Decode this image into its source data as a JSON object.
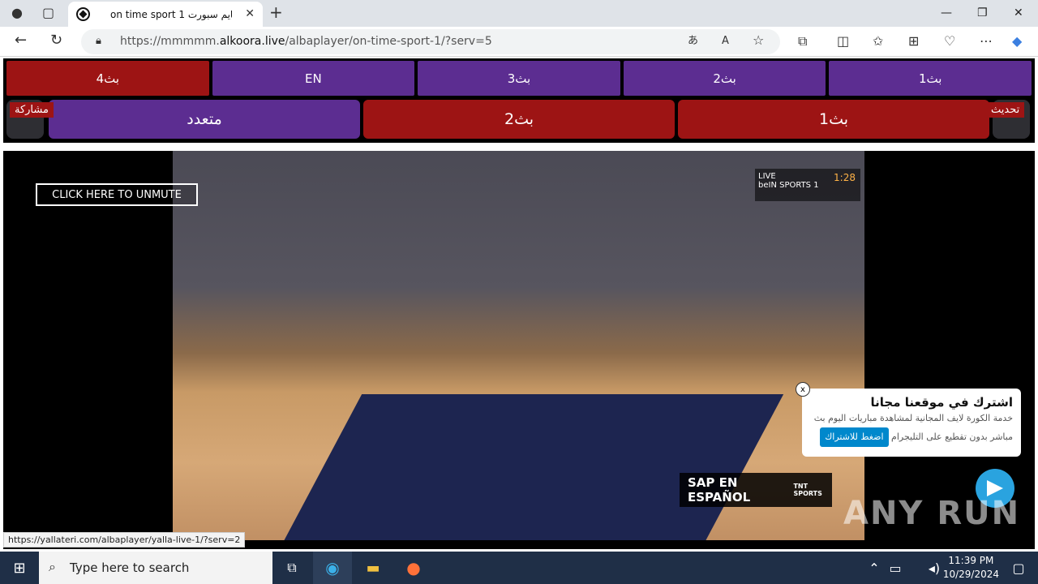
{
  "browser": {
    "tab_title": "on time sport 1 اون تايم سبورت",
    "url_prefix": "https://mmmmm.",
    "url_host": "alkoora.live",
    "url_path": "/albaplayer/on-time-sport-1/?serv=5"
  },
  "nav_row1": [
    "بث4",
    "EN",
    "بث3",
    "بث2",
    "بث1"
  ],
  "nav_row2": {
    "multi_label": "متعدد",
    "server2_label": "بث2",
    "server1_label": "بث1",
    "share_label": "مشاركة",
    "refresh_label": "تحديث"
  },
  "video": {
    "unmute_label": "CLICK HERE TO UNMUTE",
    "score_live": "LIVE",
    "score_channel": "beIN SPORTS 1",
    "score_time": "1:28",
    "sap_label": "SAP EN ESPAÑOL",
    "tnt_label": "TNT SPORTS"
  },
  "popup": {
    "title": "اشترك في موقعنا مجانا",
    "text1": "خدمة الكورة لايف المجانية لمشاهدة مباريات اليوم بث",
    "text2": "مباشر بدون تقطيع على التليجرام",
    "button_label": "اضغط للاشتراك",
    "close_label": "x"
  },
  "watermark": "ANY RUN",
  "status_link": "https://yallateri.com/albaplayer/yalla-live-1/?serv=2",
  "taskbar": {
    "search_placeholder": "Type here to search",
    "time": "11:39 PM",
    "date": "10/29/2024"
  }
}
